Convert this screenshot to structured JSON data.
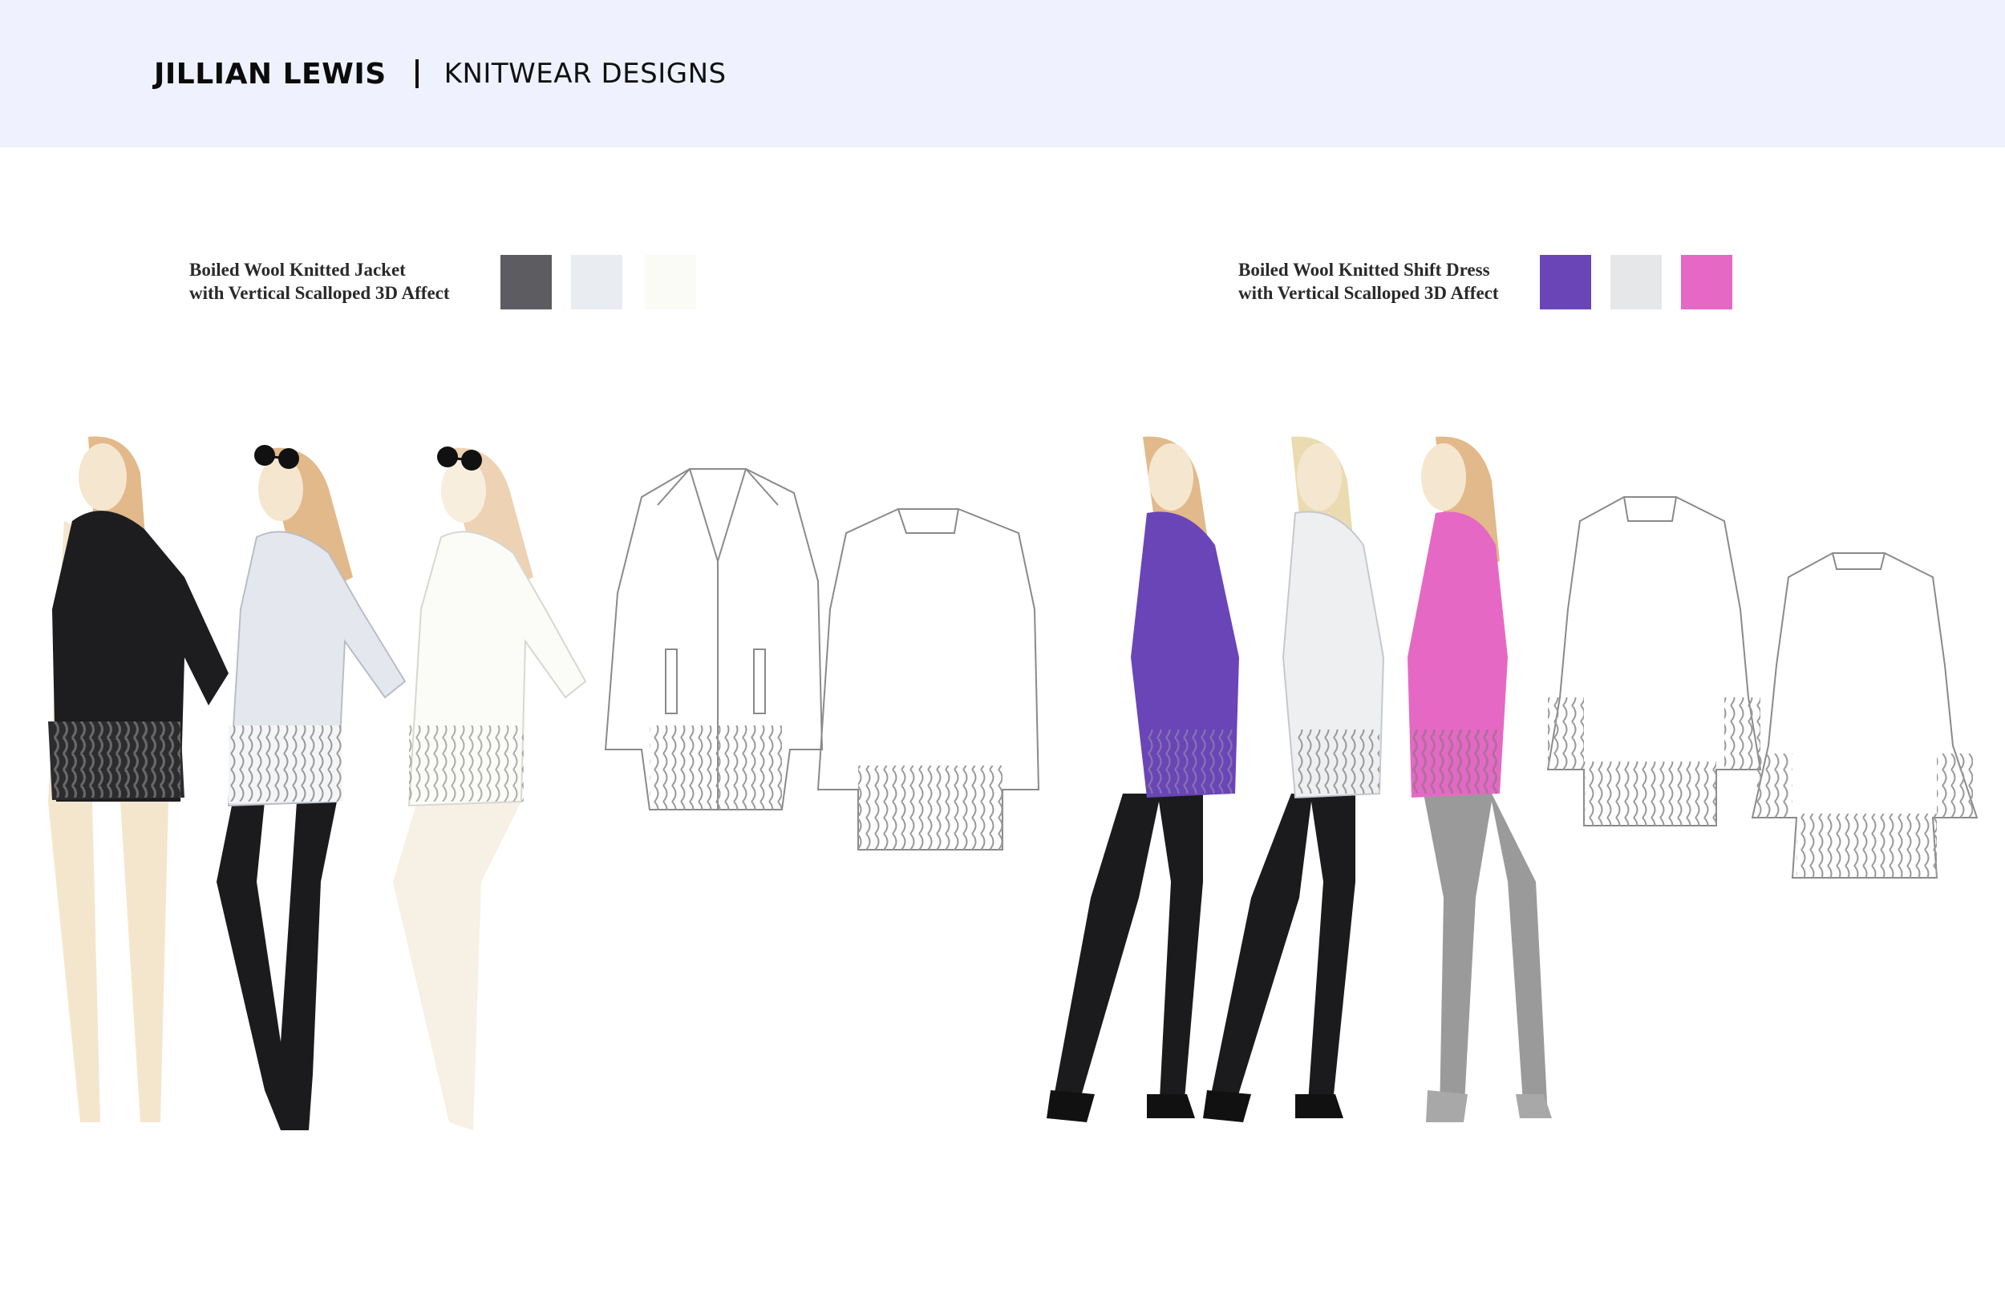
{
  "header": {
    "brand_name": "JILLIAN LEWIS",
    "brand_subtitle": "KNITWEAR DESIGNS"
  },
  "designs": [
    {
      "title_line1": "Boiled Wool Knitted Jacket",
      "title_line2": "with Vertical Scalloped 3D Affect",
      "swatches": [
        "#5d5c60",
        "#e9ecf0",
        "#fafaf6"
      ]
    },
    {
      "title_line1": "Boiled Wool Knitted Shift Dress",
      "title_line2": "with Vertical Scalloped 3D Affect",
      "swatches": [
        "#6a45b8",
        "#e6e7e9",
        "#e569c4"
      ]
    }
  ],
  "palette": {
    "header_bg": "#eff2fe",
    "hair": "#e2b98a",
    "skin": "#f5e6cf",
    "tights_black": "#1b1b1d",
    "tights_grey": "#9a9a9a"
  },
  "icons": [
    "sunglasses-icon"
  ]
}
